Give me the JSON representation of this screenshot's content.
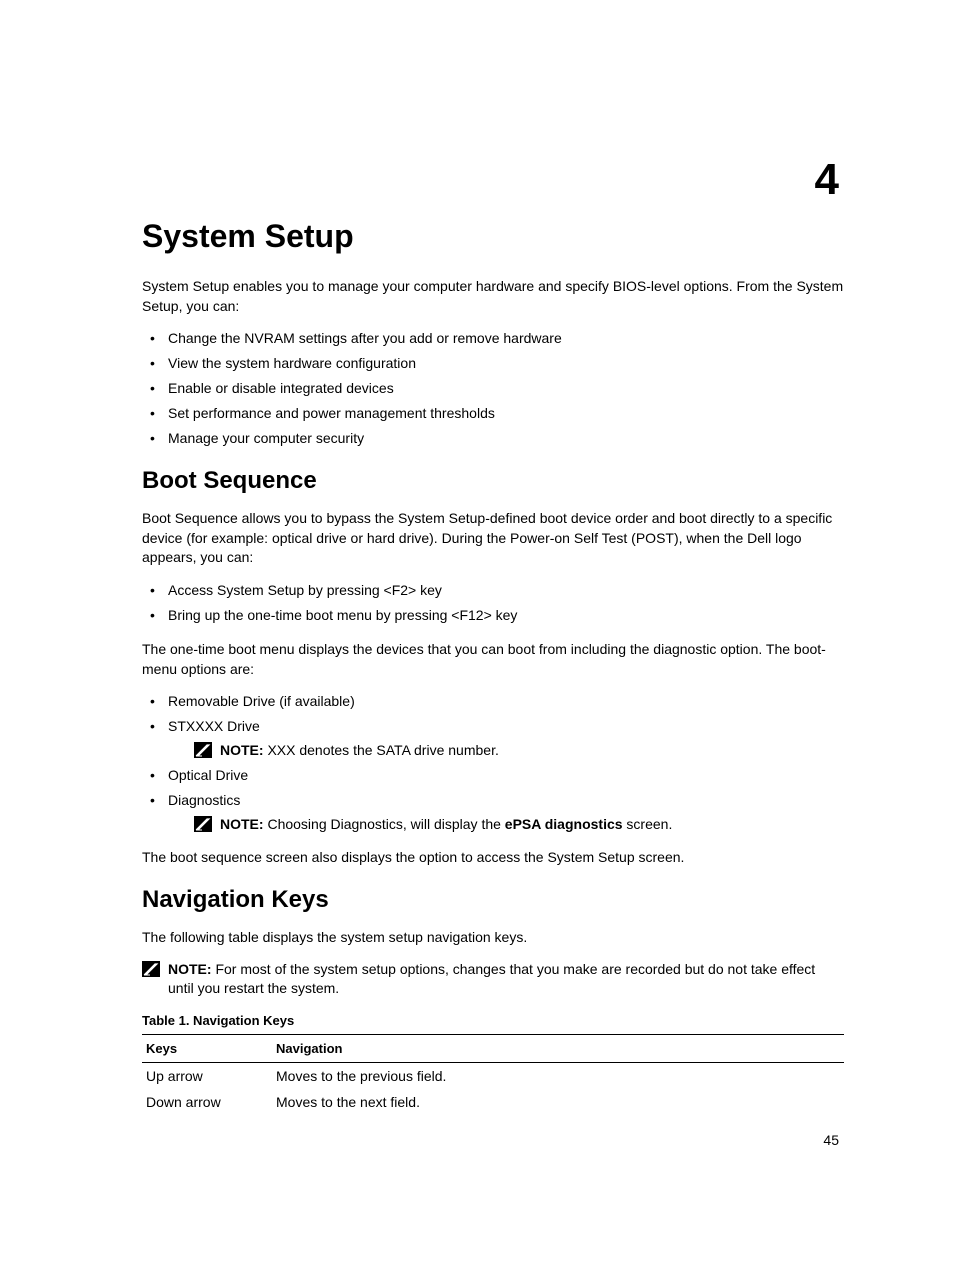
{
  "chapter_number": "4",
  "page_number": "45",
  "main_title": "System Setup",
  "intro_text": "System Setup enables you to manage your computer hardware and specify BIOS-level options. From the System Setup, you can:",
  "intro_bullets": [
    "Change the NVRAM settings after you add or remove hardware",
    "View the system hardware configuration",
    "Enable or disable integrated devices",
    "Set performance and power management thresholds",
    "Manage your computer security"
  ],
  "boot_sequence": {
    "title": "Boot Sequence",
    "intro": "Boot Sequence allows you to bypass the System Setup‑defined boot device order and boot directly to a specific device (for example: optical drive or hard drive). During the Power-on Self Test (POST), when the Dell logo appears, you can:",
    "access_bullets": [
      "Access System Setup by pressing <F2> key",
      "Bring up the one-time boot menu by pressing <F12> key"
    ],
    "menu_intro": "The one-time boot menu displays the devices that you can boot from including the diagnostic option. The boot-menu options are:",
    "options": [
      "Removable Drive (if available)",
      "STXXXX Drive",
      "Optical Drive",
      "Diagnostics"
    ],
    "note1_label": "NOTE:",
    "note1_text": " XXX denotes the SATA drive number.",
    "note2_label": "NOTE:",
    "note2_text_before": " Choosing Diagnostics, will display the ",
    "note2_bold": "ePSA diagnostics",
    "note2_text_after": " screen.",
    "closing": "The boot sequence screen also displays the option to access the System Setup screen."
  },
  "navigation_keys": {
    "title": "Navigation Keys",
    "intro": "The following table displays the system setup navigation keys.",
    "note_label": "NOTE:",
    "note_text": " For most of the system setup options, changes that you make are recorded but do not take effect until you restart the system.",
    "table_title": "Table 1. Navigation Keys",
    "headers": [
      "Keys",
      "Navigation"
    ],
    "rows": [
      [
        "Up arrow",
        "Moves to the previous field."
      ],
      [
        "Down arrow",
        "Moves to the next field."
      ]
    ]
  }
}
